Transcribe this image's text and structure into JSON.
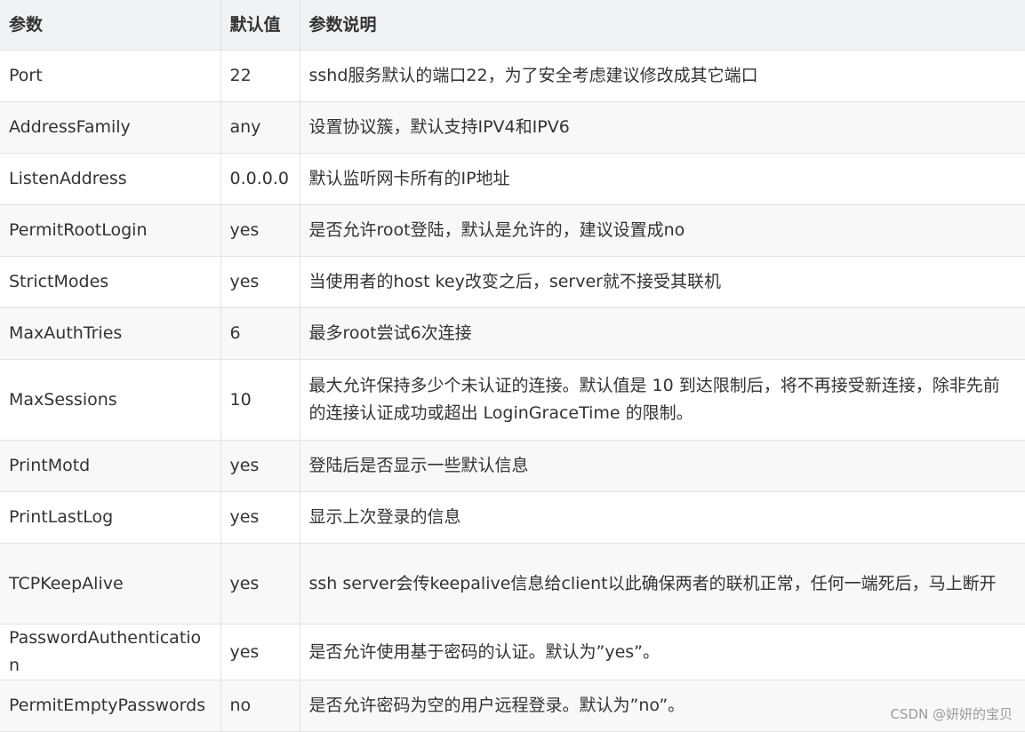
{
  "table": {
    "headers": [
      "参数",
      "默认值",
      "参数说明"
    ],
    "rows": [
      {
        "param": "Port",
        "default": "22",
        "desc": "sshd服务默认的端口22，为了安全考虑建议修改成其它端口"
      },
      {
        "param": "AddressFamily",
        "default": "any",
        "desc": "设置协议簇，默认支持IPV4和IPV6"
      },
      {
        "param": "ListenAddress",
        "default": "0.0.0.0",
        "desc": "默认监听网卡所有的IP地址"
      },
      {
        "param": "PermitRootLogin",
        "default": "yes",
        "desc": "是否允许root登陆，默认是允许的，建议设置成no"
      },
      {
        "param": "StrictModes",
        "default": "yes",
        "desc": "当使用者的host key改变之后，server就不接受其联机"
      },
      {
        "param": "MaxAuthTries",
        "default": "6",
        "desc": "最多root尝试6次连接"
      },
      {
        "param": "MaxSessions",
        "default": "10",
        "desc": "最大允许保持多少个未认证的连接。默认值是 10 到达限制后，将不再接受新连接，除非先前的连接认证成功或超出 LoginGraceTime 的限制。"
      },
      {
        "param": "PrintMotd",
        "default": "yes",
        "desc": "登陆后是否显示一些默认信息"
      },
      {
        "param": "PrintLastLog",
        "default": "yes",
        "desc": "显示上次登录的信息"
      },
      {
        "param": "TCPKeepAlive",
        "default": "yes",
        "desc": "ssh server会传keepalive信息给client以此确保两者的联机正常，任何一端死后，马上断开"
      },
      {
        "param": "PasswordAuthentication",
        "default": "yes",
        "desc": "是否允许使用基于密码的认证。默认为”yes”。"
      },
      {
        "param": "PermitEmptyPasswords",
        "default": "no",
        "desc": "是否允许密码为空的用户远程登录。默认为”no”。"
      }
    ]
  },
  "watermark": "CSDN @妍妍的宝贝",
  "colors": {
    "header_bg": "#eff3f5",
    "stripe_bg": "#f8f8f8",
    "border": "#dfe2e5",
    "text": "#333333"
  }
}
